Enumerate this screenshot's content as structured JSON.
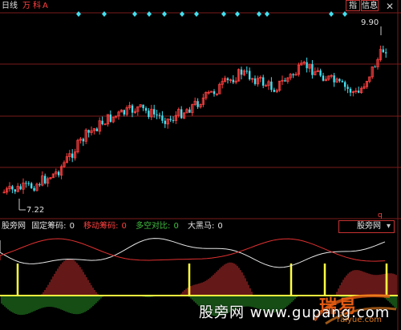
{
  "toolbar": {
    "period": "日线",
    "wan": "万",
    "ke": "科",
    "a_label": "A",
    "zhi": "指",
    "info": "信息",
    "close": "✕"
  },
  "price": {
    "high_label": "9.90",
    "low_label": "7.22",
    "q_marker": "q"
  },
  "indicator": {
    "name": "股旁网",
    "items": [
      {
        "label": "固定筹码:",
        "value": "0",
        "color": "#e0e0e0"
      },
      {
        "label": "移动筹码:",
        "value": "0",
        "color": "#ff4040"
      },
      {
        "label": "多空对比:",
        "value": "0",
        "color": "#40c040"
      },
      {
        "label": "大黑马:",
        "value": "0",
        "color": "#e0e0e0"
      }
    ],
    "select_value": "股旁网"
  },
  "watermark": {
    "text": "股旁网 www.gupang.com",
    "logo_text": "瑞易",
    "domain": "raiyue.com"
  },
  "colors": {
    "up": "#ff4040",
    "down": "#40e0f0",
    "gold": "#ffff40",
    "grid": "#7a1a1a",
    "diamond": "#40e0f0"
  }
}
